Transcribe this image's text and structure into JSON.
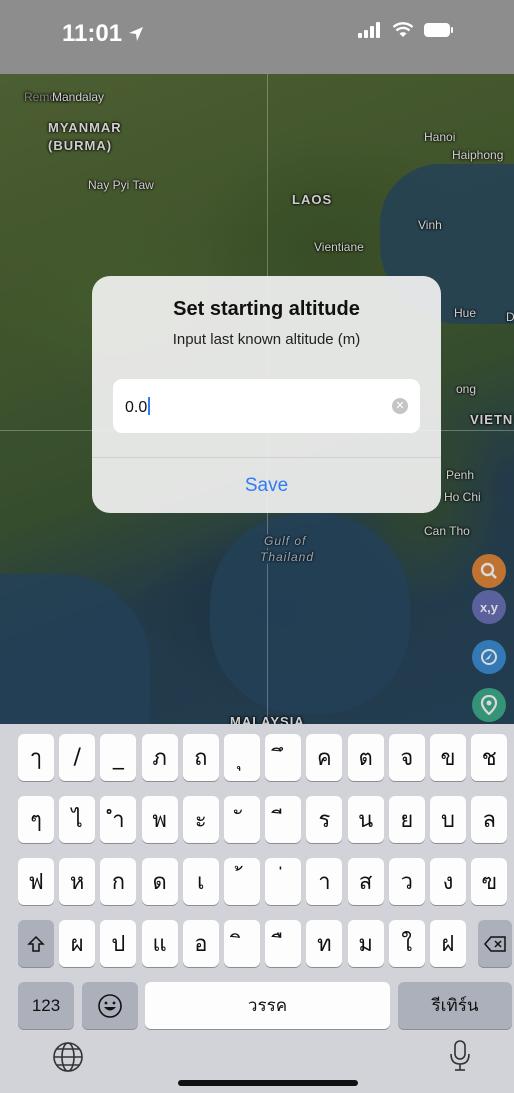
{
  "status": {
    "time": "11:01"
  },
  "map": {
    "labels": [
      {
        "text": "Remove",
        "cls": "faded"
      },
      {
        "text": "Mandalay",
        "cls": ""
      },
      {
        "text": "MYANMAR",
        "cls": "country"
      },
      {
        "text": "(BURMA)",
        "cls": "country"
      },
      {
        "text": "Nay Pyi Taw",
        "cls": ""
      },
      {
        "text": "LAOS",
        "cls": "country"
      },
      {
        "text": "Vientiane",
        "cls": ""
      },
      {
        "text": "Hanoi",
        "cls": ""
      },
      {
        "text": "Haiphong",
        "cls": ""
      },
      {
        "text": "Vinh",
        "cls": ""
      },
      {
        "text": "Hue",
        "cls": ""
      },
      {
        "text": "D",
        "cls": ""
      },
      {
        "text": "ong",
        "cls": ""
      },
      {
        "text": "VIETN",
        "cls": "country"
      },
      {
        "text": "Penh",
        "cls": ""
      },
      {
        "text": "Ho Chi",
        "cls": ""
      },
      {
        "text": "Can Tho",
        "cls": ""
      },
      {
        "text": "Gulf of",
        "cls": "sea"
      },
      {
        "text": "Thailand",
        "cls": "sea"
      },
      {
        "text": "MALAYSIA",
        "cls": "country"
      }
    ],
    "buttons": [
      {
        "name": "search-icon",
        "label": "",
        "color": "#e2863a"
      },
      {
        "name": "coordinates-button",
        "label": "x,y",
        "color": "#6b72b8"
      },
      {
        "name": "compass-icon",
        "label": "",
        "color": "#3c8fd6"
      },
      {
        "name": "location-pin-icon",
        "label": "",
        "color": "#3fae8c"
      }
    ]
  },
  "dialog": {
    "title": "Set starting altitude",
    "subtitle": "Input last known altitude (m)",
    "input_value": "0.0",
    "save_label": "Save"
  },
  "keyboard": {
    "row1": [
      "ๅ",
      "/",
      "_",
      "ภ",
      "ถ",
      "ุ",
      "ึ",
      "ค",
      "ต",
      "จ",
      "ข",
      "ช"
    ],
    "row2": [
      "ๆ",
      "ไ",
      "ำ",
      "พ",
      "ะ",
      "ั",
      "ี",
      "ร",
      "น",
      "ย",
      "บ",
      "ล"
    ],
    "row3": [
      "ฟ",
      "ห",
      "ก",
      "ด",
      "เ",
      "้",
      "่",
      "า",
      "ส",
      "ว",
      "ง",
      "ฃ"
    ],
    "row4": [
      "ผ",
      "ป",
      "แ",
      "อ",
      "ิ",
      "ื",
      "ท",
      "ม",
      "ใ",
      "ฝ"
    ],
    "numbers_label": "123",
    "space_label": "วรรค",
    "return_label": "รีเทิร์น"
  }
}
